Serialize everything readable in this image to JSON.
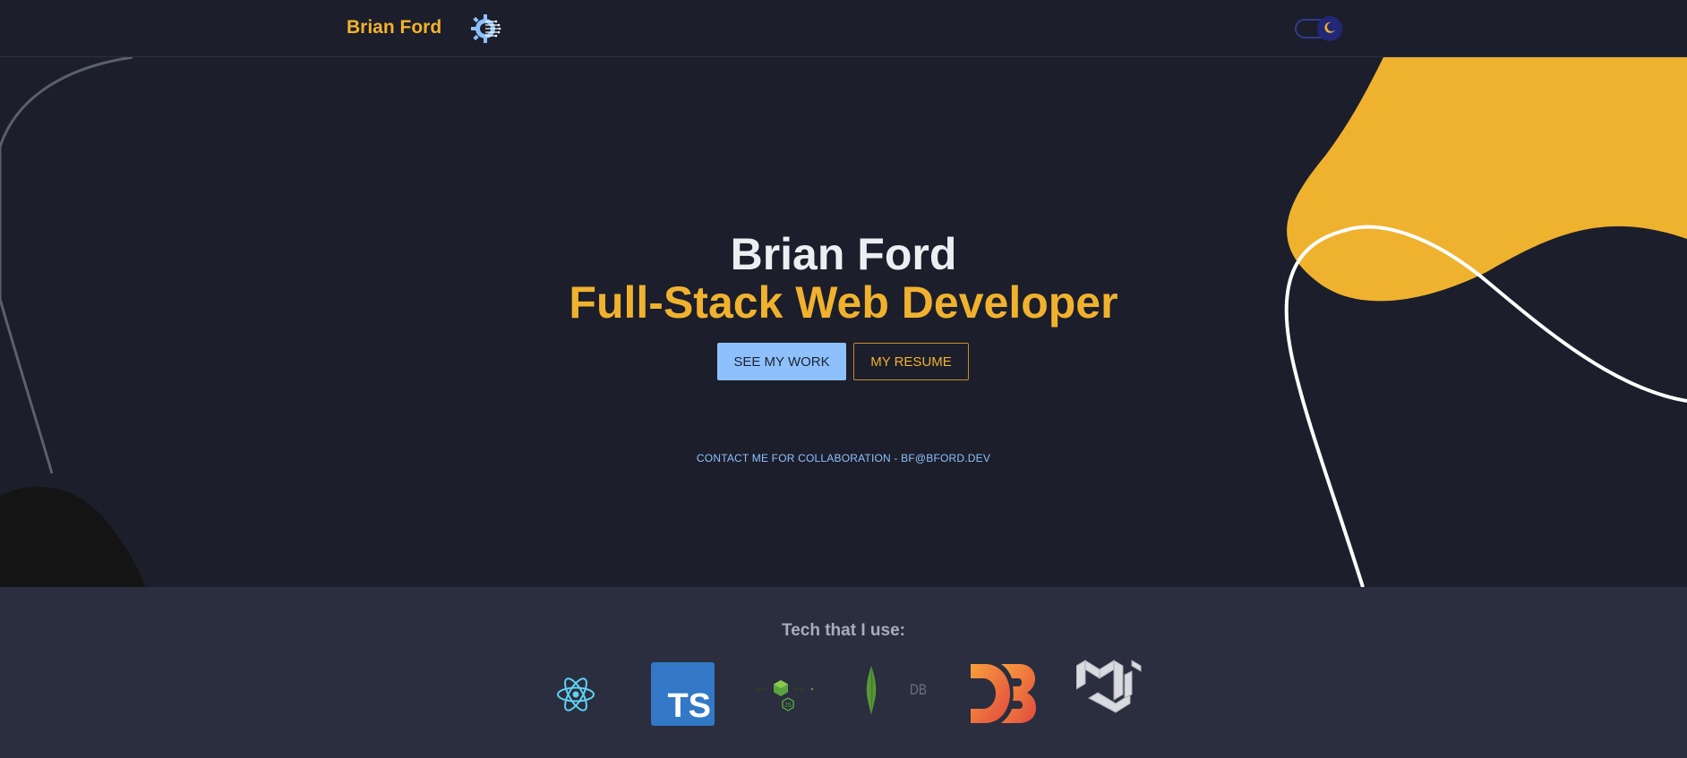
{
  "nav": {
    "brand": "Brian Ford",
    "logo_icon": "gear-circuit-icon",
    "theme_toggle_icon": "moon-icon",
    "theme_mode": "dark"
  },
  "hero": {
    "name": "Brian Ford",
    "role": "Full-Stack Web Developer",
    "primary_button": "SEE MY WORK",
    "secondary_button": "MY RESUME",
    "contact": "CONTACT ME FOR COLLABORATION - BF@BFORD.DEV"
  },
  "tech": {
    "title": "Tech that I use:",
    "icons": [
      {
        "name": "react-icon",
        "label": "React"
      },
      {
        "name": "typescript-icon",
        "label": "TS"
      },
      {
        "name": "nodejs-icon",
        "label": "Node.js"
      },
      {
        "name": "mongodb-icon",
        "label": "DB"
      },
      {
        "name": "d3-icon",
        "label": "D3"
      },
      {
        "name": "material-ui-icon",
        "label": "MUI"
      }
    ]
  },
  "colors": {
    "background": "#1c1e2b",
    "accent_yellow": "#f0b22e",
    "accent_blue": "#8ec1fb",
    "tech_bg": "#2a2e3f"
  }
}
